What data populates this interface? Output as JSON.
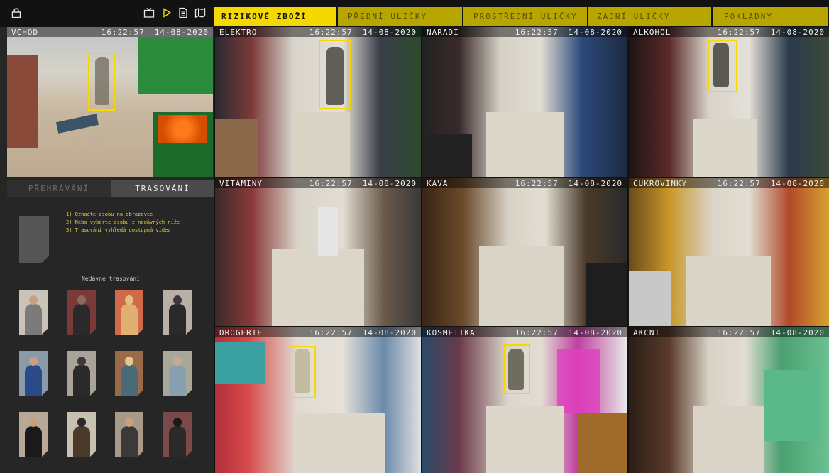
{
  "toolbar": {
    "lock_icon": "lock-icon",
    "tv_icon": "tv-icon",
    "play_icon": "play-icon",
    "document_icon": "document-icon",
    "map_icon": "map-icon"
  },
  "tabs": [
    {
      "label": "RIZIKOVÉ ZBOŽÍ",
      "active": true
    },
    {
      "label": "PŘEDNÍ ULIČKY",
      "active": false
    },
    {
      "label": "PROSTŘEDNÍ ULIČKY",
      "active": false
    },
    {
      "label": "ZADNÍ ULIČKY",
      "active": false
    },
    {
      "label": "POKLADNY",
      "active": false
    }
  ],
  "cameras": [
    {
      "name": "VCHOD",
      "time": "16:22:57",
      "date": "14-08-2020",
      "tracked": true
    },
    {
      "name": "ELEKTRO",
      "time": "16:22:57",
      "date": "14-08-2020",
      "tracked": true
    },
    {
      "name": "NARADI",
      "time": "16:22:57",
      "date": "14-08-2020",
      "tracked": false
    },
    {
      "name": "ALKOHOL",
      "time": "16:22:57",
      "date": "14-08-2020",
      "tracked": true
    },
    {
      "name": "VITAMINY",
      "time": "16:22:57",
      "date": "14-08-2020",
      "tracked": false
    },
    {
      "name": "KAVA",
      "time": "16:22:57",
      "date": "14-08-2020",
      "tracked": false
    },
    {
      "name": "CUKROVINKY",
      "time": "16:22:57",
      "date": "14-08-2020",
      "tracked": false
    },
    {
      "name": "DROGERIE",
      "time": "16:22:57",
      "date": "14-08-2020",
      "tracked": true
    },
    {
      "name": "KOSMETIKA",
      "time": "16:22:57",
      "date": "14-08-2020",
      "tracked": true
    },
    {
      "name": "AKCNI",
      "time": "16:22:57",
      "date": "14-08-2020",
      "tracked": false
    }
  ],
  "modes": {
    "playback": "PŘEHRÁVÁNÍ",
    "tracking": "TRASOVÁNÍ",
    "active": "tracking"
  },
  "instructions": [
    "1) Označte osobu na obrazovce",
    "2) Nebo vyberte osobu z nedávných níže",
    "3) Trasování vyhledá dostupná videa"
  ],
  "recent_title": "Nedávné trasování",
  "recent_count": 12,
  "colors": {
    "accent": "#f4d800",
    "tab_inactive": "#b8a600",
    "panel": "#262626",
    "background": "#121212"
  }
}
